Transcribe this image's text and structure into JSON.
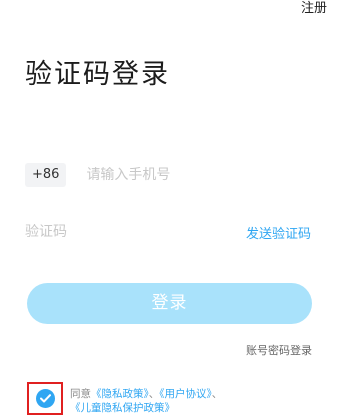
{
  "header": {
    "register_label": "注册"
  },
  "title": "验证码登录",
  "phone": {
    "country_code": "+86",
    "placeholder": "请输入手机号"
  },
  "code": {
    "placeholder": "验证码",
    "send_label": "发送验证码"
  },
  "login_button_label": "登录",
  "password_login_label": "账号密码登录",
  "agreement": {
    "checked": true,
    "prefix": "同意",
    "privacy_policy": "《隐私政策》",
    "separator1": "、",
    "user_agreement": "《用户协议》",
    "separator2": "、",
    "children_privacy": "《儿童隐私保护政策》"
  },
  "colors": {
    "accent": "#2fa6f2",
    "button_disabled": "#a9e2fb",
    "highlight_border": "#e02020"
  }
}
